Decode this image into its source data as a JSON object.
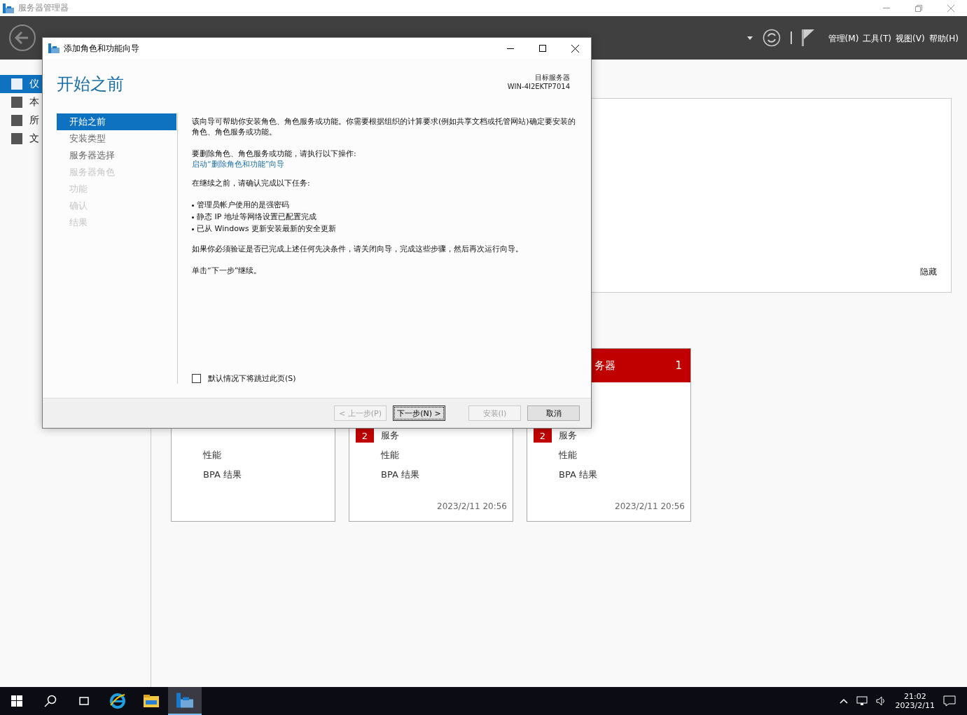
{
  "window": {
    "title": "服务器管理器"
  },
  "menu": [
    {
      "label": "管理(M)"
    },
    {
      "label": "工具(T)"
    },
    {
      "label": "视图(V)"
    },
    {
      "label": "帮助(H)"
    }
  ],
  "sidebar": {
    "items": [
      {
        "label": "仪",
        "selected": true
      },
      {
        "label": "本",
        "selected": false
      },
      {
        "label": "所",
        "selected": false
      },
      {
        "label": "文",
        "selected": false
      }
    ]
  },
  "welcome_panel": {
    "hide_link": "隐藏"
  },
  "cards": [
    {
      "rows": [
        {
          "label": "性能"
        },
        {
          "label": "BPA 结果"
        }
      ]
    },
    {
      "rows": [
        {
          "label": "服务",
          "badge": "2"
        },
        {
          "label": "性能"
        },
        {
          "label": "BPA 结果"
        }
      ],
      "timestamp": "2023/2/11 20:56"
    },
    {
      "header": {
        "title": "务器",
        "count": "1"
      },
      "rows": [
        {
          "label": "服务",
          "badge": "2"
        },
        {
          "label": "性能"
        },
        {
          "label": "BPA 结果"
        }
      ],
      "timestamp": "2023/2/11 20:56"
    }
  ],
  "dialog": {
    "title": "添加角色和功能向导",
    "heading": "开始之前",
    "target_label": "目标服务器",
    "target_server": "WIN-4I2EKTP7014",
    "steps": [
      {
        "label": "开始之前",
        "selected": true,
        "disabled": false
      },
      {
        "label": "安装类型",
        "selected": false,
        "disabled": false
      },
      {
        "label": "服务器选择",
        "selected": false,
        "disabled": false
      },
      {
        "label": "服务器角色",
        "selected": false,
        "disabled": true
      },
      {
        "label": "功能",
        "selected": false,
        "disabled": true
      },
      {
        "label": "确认",
        "selected": false,
        "disabled": true
      },
      {
        "label": "结果",
        "selected": false,
        "disabled": true
      }
    ],
    "blocks": [
      {
        "kind": "para",
        "text": "该向导可帮助你安装角色、角色服务或功能。你需要根据组织的计算要求(例如共享文档或托管网站)确定要安装的角色、角色服务或功能。"
      },
      {
        "kind": "para",
        "text": "要删除角色、角色服务或功能，请执行以下操作:",
        "link": "启动“删除角色和功能”向导"
      },
      {
        "kind": "para",
        "text": "在继续之前，请确认完成以下任务:"
      },
      {
        "kind": "bullets",
        "items": [
          "管理员帐户使用的是强密码",
          "静态 IP 地址等网络设置已配置完成",
          "已从 Windows 更新安装最新的安全更新"
        ]
      },
      {
        "kind": "para",
        "text": "如果你必须验证是否已完成上述任何先决条件，请关闭向导，完成这些步骤，然后再次运行向导。"
      },
      {
        "kind": "para",
        "text": "单击“下一步”继续。"
      }
    ],
    "skip_checkbox": {
      "label": "默认情况下将跳过此页(S)",
      "checked": false
    },
    "buttons": [
      {
        "label": "< 上一步(P)",
        "disabled": true,
        "focused": false
      },
      {
        "label": "下一步(N) >",
        "disabled": false,
        "focused": true
      },
      {
        "label": "安装(I)",
        "disabled": true,
        "focused": false
      },
      {
        "label": "取消",
        "disabled": false,
        "focused": false
      }
    ]
  },
  "taskbar": {
    "time": "21:02",
    "date": "2023/2/11"
  }
}
